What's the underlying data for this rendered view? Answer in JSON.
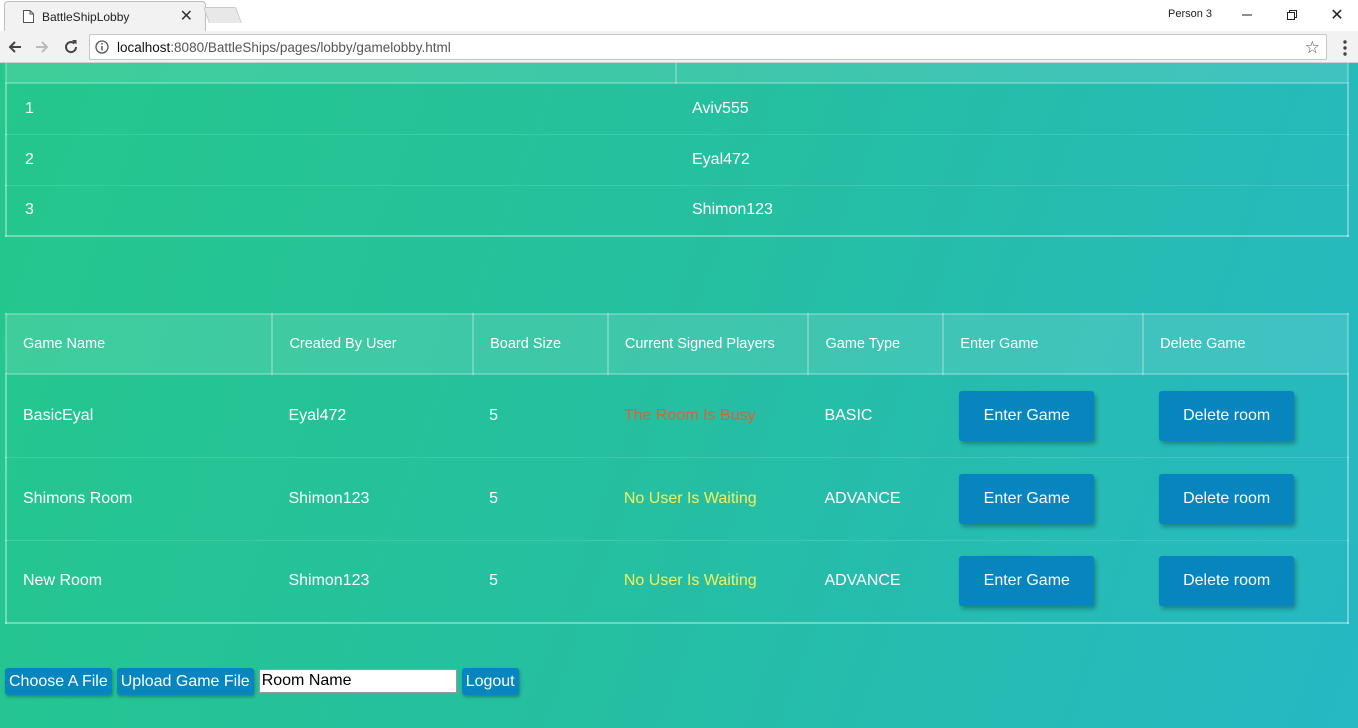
{
  "browser": {
    "tab_title": "BattleShipLobby",
    "profile_name": "Person 3",
    "url_host": "localhost",
    "url_rest": ":8080/BattleShips/pages/lobby/gamelobby.html"
  },
  "users_table": {
    "rows": [
      {
        "num": "1",
        "name": "Aviv555"
      },
      {
        "num": "2",
        "name": "Eyal472"
      },
      {
        "num": "3",
        "name": "Shimon123"
      }
    ]
  },
  "games_table": {
    "headers": [
      "Game Name",
      "Created By User",
      "Board Size",
      "Current Signed Players",
      "Game Type",
      "Enter Game",
      "Delete Game"
    ],
    "rows": [
      {
        "name": "BasicEyal",
        "creator": "Eyal472",
        "size": "5",
        "status": "The Room Is Busy",
        "type": "BASIC",
        "enter": "Enter Game",
        "delete": "Delete room"
      },
      {
        "name": "Shimons Room",
        "creator": "Shimon123",
        "size": "5",
        "status": "No User Is Waiting",
        "type": "ADVANCE",
        "enter": "Enter Game",
        "delete": "Delete room"
      },
      {
        "name": "New Room",
        "creator": "Shimon123",
        "size": "5",
        "status": "No User Is Waiting",
        "type": "ADVANCE",
        "enter": "Enter Game",
        "delete": "Delete room"
      }
    ]
  },
  "controls": {
    "choose_file": "Choose A File",
    "upload": "Upload Game File",
    "room_name_value": "Room Name",
    "logout": "Logout"
  },
  "colors": {
    "button_blue": "#0685bf",
    "status_busy": "#e35b3a",
    "status_waiting": "#f4f15a",
    "gradient_start": "#25c78c",
    "gradient_end": "#26b8c4"
  }
}
